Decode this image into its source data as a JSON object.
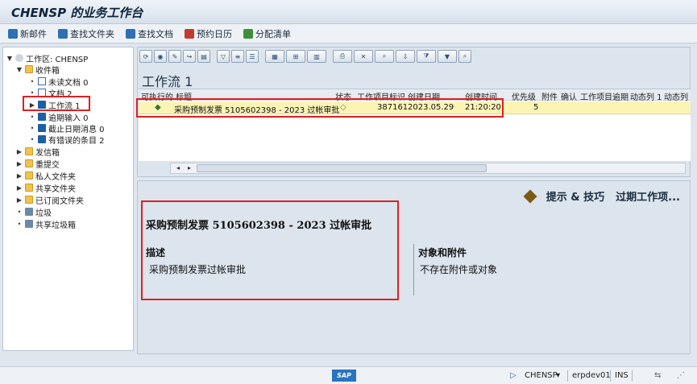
{
  "window": {
    "title": "CHENSP 的业务工作台"
  },
  "appbar": {
    "new_mail": "新邮件",
    "find_folder": "查找文件夹",
    "find_doc": "查找文档",
    "calendar": "预约日历",
    "distribution": "分配清单"
  },
  "tree": {
    "root": "工作区: CHENSP",
    "inbox": "收件箱",
    "unread": "未读文档 0",
    "docs": "文档 2",
    "workflow": "工作流 1",
    "overdue": "逾期输入 0",
    "deadline": "截止日期消息 0",
    "errors": "有错误的条目 2",
    "outbox": "发信箱",
    "resubmit": "重提交",
    "private": "私人文件夹",
    "shared": "共享文件夹",
    "subscribed": "已订阅文件夹",
    "trash": "垃圾",
    "shared_trash": "共享垃圾箱"
  },
  "workflow": {
    "heading": "工作流 1",
    "columns": {
      "title": "可执行的 标题",
      "status": "状态",
      "item_id": "工作项目标识",
      "created_date": "创建日期",
      "created_time": "创建时间",
      "priority": "优先级",
      "attachment": "附件",
      "confirm": "确认",
      "overdue": "工作项目逾期",
      "dyn1": "动态列 1",
      "dyn2": "动态列"
    },
    "rows": [
      {
        "title": "采购预制发票 5105602398 - 2023 过帐审批",
        "item_id": "387161",
        "created_date": "2023.05.29",
        "created_time": "21:20:20",
        "priority": "5"
      }
    ]
  },
  "detail": {
    "tips": "提示 & 技巧",
    "overdue_items": "过期工作项...",
    "title": "采购预制发票 5105602398 - 2023 过帐审批",
    "desc_label": "描述",
    "desc_text": "采购预制发票过帐审批",
    "obj_label": "对象和附件",
    "obj_text": "不存在附件或对象"
  },
  "statusbar": {
    "user": "CHENSP",
    "server": "erpdev01",
    "mode": "INS",
    "logo": "SAP"
  },
  "colors": {
    "highlight_row": "#fcf4b5",
    "annotation_red": "#e02020"
  }
}
